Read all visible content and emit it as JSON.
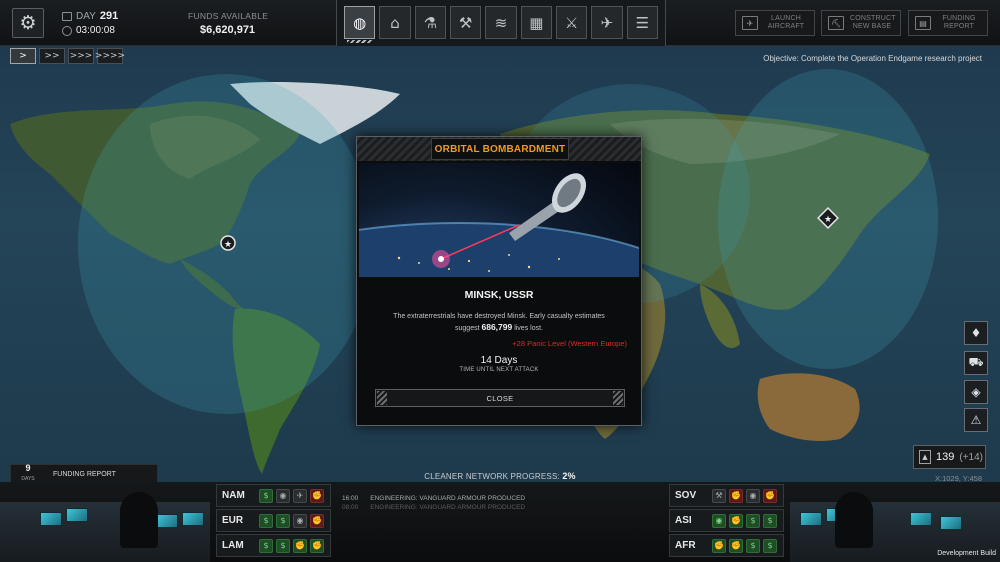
{
  "topbar": {
    "day_label": "DAY",
    "day_value": "291",
    "time": "03:00:08",
    "funds_label": "FUNDS AVAILABLE",
    "funds_value": "$6,620,971",
    "nav_tabs": [
      {
        "icon": "globe-icon",
        "glyph": "◍"
      },
      {
        "icon": "hangar-icon",
        "glyph": "⌂"
      },
      {
        "icon": "research-flask-icon",
        "glyph": "⚗"
      },
      {
        "icon": "engineering-wrench-icon",
        "glyph": "⚒"
      },
      {
        "icon": "soldier-rank-icon",
        "glyph": "≋"
      },
      {
        "icon": "base-facilities-icon",
        "glyph": "▦"
      },
      {
        "icon": "weapons-rifle-icon",
        "glyph": "⚔"
      },
      {
        "icon": "aircraft-jet-icon",
        "glyph": "✈"
      },
      {
        "icon": "archive-cabinet-icon",
        "glyph": "☰"
      }
    ],
    "launch_aircraft": "LAUNCH AIRCRAFT",
    "construct_base": "CONSTRUCT NEW BASE",
    "funding_report": "FUNDING REPORT"
  },
  "speed": [
    ">",
    ">>",
    ">>>",
    ">>>>"
  ],
  "objective": "Objective: Complete the Operation Endgame research project",
  "modal": {
    "title": "ORBITAL BOMBARDMENT",
    "city": "MINSK, USSR",
    "body_line1": "The extraterrestrials have destroyed Minsk. Early casualty estimates",
    "body_line2_prefix": "suggest",
    "casualties": "686,799",
    "body_line2_suffix": "lives lost.",
    "panic": "+28 Panic Level (Western Europe)",
    "days": "14 Days",
    "days_sub": "TIME UNTIL NEXT ATTACK",
    "close_label": "CLOSE"
  },
  "scientists": {
    "value": "139",
    "increment": "(+14)"
  },
  "cursor_coords": "X:1029, Y:458",
  "funding_panel": {
    "days": "9",
    "days_unit": "DAYS",
    "label": "FUNDING REPORT"
  },
  "cleaner": {
    "label": "CLEANER NETWORK PROGRESS:",
    "value": "2%"
  },
  "regions_left": [
    {
      "name": "NAM",
      "icons": [
        "g",
        "n",
        "n",
        "r"
      ]
    },
    {
      "name": "EUR",
      "icons": [
        "g",
        "g",
        "n",
        "r"
      ]
    },
    {
      "name": "LAM",
      "icons": [
        "g",
        "g",
        "g",
        "g"
      ]
    }
  ],
  "regions_right": [
    {
      "name": "SOV",
      "icons": [
        "n",
        "r",
        "n",
        "r"
      ]
    },
    {
      "name": "ASI",
      "icons": [
        "g",
        "g",
        "g",
        "g"
      ]
    },
    {
      "name": "AFR",
      "icons": [
        "g",
        "g",
        "g",
        "g"
      ]
    }
  ],
  "log": [
    {
      "time": "16:00",
      "text": "ENGINEERING: VANGUARD ARMOUR PRODUCED"
    },
    {
      "time": "08:00",
      "text": "ENGINEERING: VANGUARD ARMOUR PRODUCED"
    }
  ],
  "dev_build": "Development Build",
  "colors": {
    "accent": "#f09a22",
    "panic": "#e02a22",
    "radar": "#3fa8c0"
  }
}
